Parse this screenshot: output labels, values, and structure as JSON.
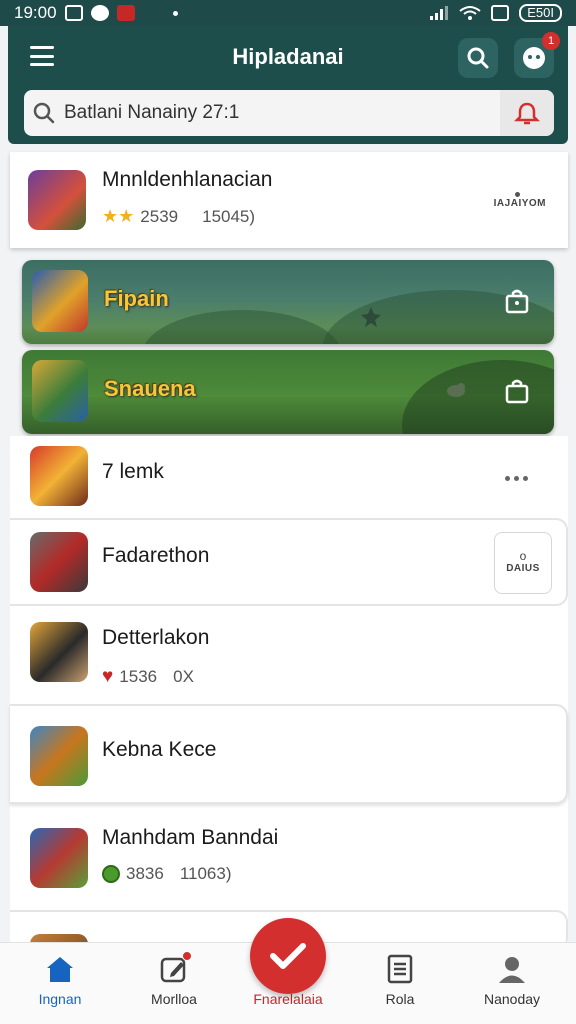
{
  "status_bar": {
    "time": "19:00",
    "battery": "E50I"
  },
  "header": {
    "title": "Hipladanai",
    "notification_count": "1",
    "search": {
      "value": "Batlani Nanainy 27:1"
    }
  },
  "featured": {
    "title": "Mnnldenhlanacian",
    "rating": "2539",
    "downloads": "15045)",
    "side_label": "IAJAIYOM"
  },
  "banners": [
    {
      "title": "Fipain"
    },
    {
      "title": "Snauena"
    }
  ],
  "items": [
    {
      "title": "7 lemk"
    },
    {
      "title": "Fadarethon",
      "action_label": "DAIUS",
      "action_top": "o"
    },
    {
      "title": "Detterlakon",
      "stat_a": "1536",
      "stat_b": "0X"
    },
    {
      "title": "Kebna Kece"
    },
    {
      "title": "Manhdam Banndai",
      "stat_a": "3836",
      "stat_b": "11063)"
    }
  ],
  "nav": [
    {
      "label": "Ingnan",
      "icon": "home-icon"
    },
    {
      "label": "Morlloa",
      "icon": "edit-icon"
    },
    {
      "label": "Fnarelalaia",
      "icon": "check-icon"
    },
    {
      "label": "Rola",
      "icon": "document-icon"
    },
    {
      "label": "Nanoday",
      "icon": "profile-icon"
    }
  ],
  "colors": {
    "header": "#1e4e4b",
    "accent": "#d32f2f",
    "active_nav": "#1565c0",
    "star": "#f2b01e"
  }
}
